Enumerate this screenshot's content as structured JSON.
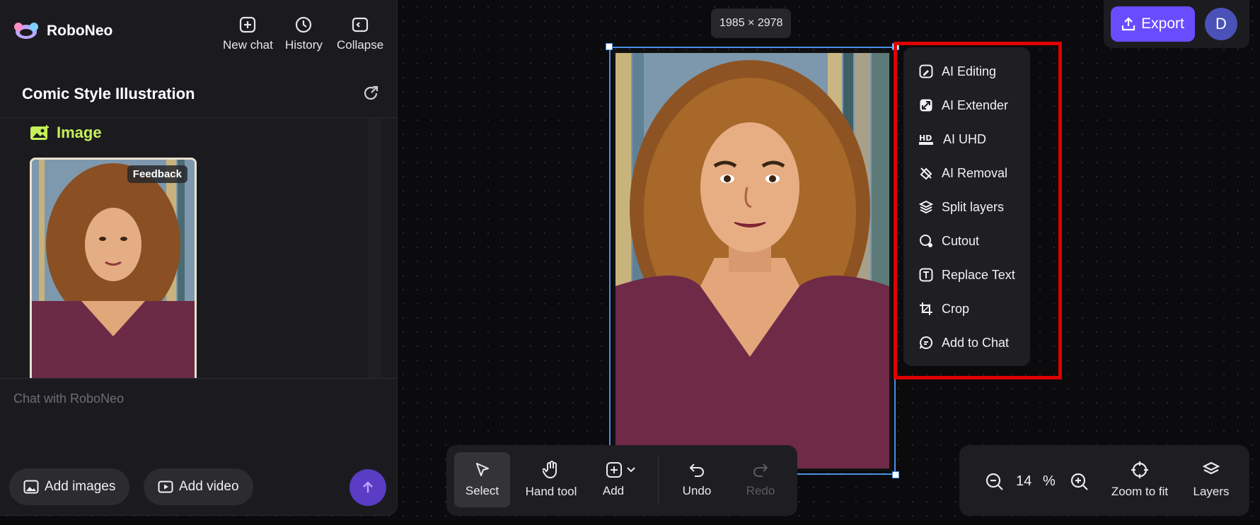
{
  "app": {
    "name": "RoboNeo"
  },
  "header": {
    "new_chat": "New chat",
    "history": "History",
    "collapse": "Collapse"
  },
  "conversation": {
    "title": "Comic Style Illustration",
    "image_section_label": "Image",
    "feedback_label": "Feedback",
    "input_placeholder": "Chat with RoboNeo",
    "add_images": "Add images",
    "add_video": "Add video"
  },
  "canvas": {
    "dimensions": "1985 × 2978"
  },
  "context_menu": {
    "items": [
      {
        "label": "AI Editing",
        "icon": "ai-editing-icon"
      },
      {
        "label": "AI Extender",
        "icon": "ai-extender-icon"
      },
      {
        "label": "AI UHD",
        "icon": "hd-icon"
      },
      {
        "label": "AI Removal",
        "icon": "eraser-icon"
      },
      {
        "label": "Split layers",
        "icon": "layers-icon"
      },
      {
        "label": "Cutout",
        "icon": "cutout-icon"
      },
      {
        "label": "Replace Text",
        "icon": "text-icon"
      },
      {
        "label": "Crop",
        "icon": "crop-icon"
      },
      {
        "label": "Add to Chat",
        "icon": "chat-icon"
      }
    ]
  },
  "topbar": {
    "export": "Export",
    "avatar_initial": "D"
  },
  "toolbar": {
    "select": "Select",
    "hand_tool": "Hand tool",
    "add": "Add",
    "undo": "Undo",
    "redo": "Redo"
  },
  "zoom": {
    "value": "14",
    "unit": "%",
    "zoom_to_fit": "Zoom to fit",
    "layers": "Layers"
  },
  "colors": {
    "accent": "#6a4cff",
    "highlight_border": "#e00000",
    "image_label": "#c6f05a"
  }
}
